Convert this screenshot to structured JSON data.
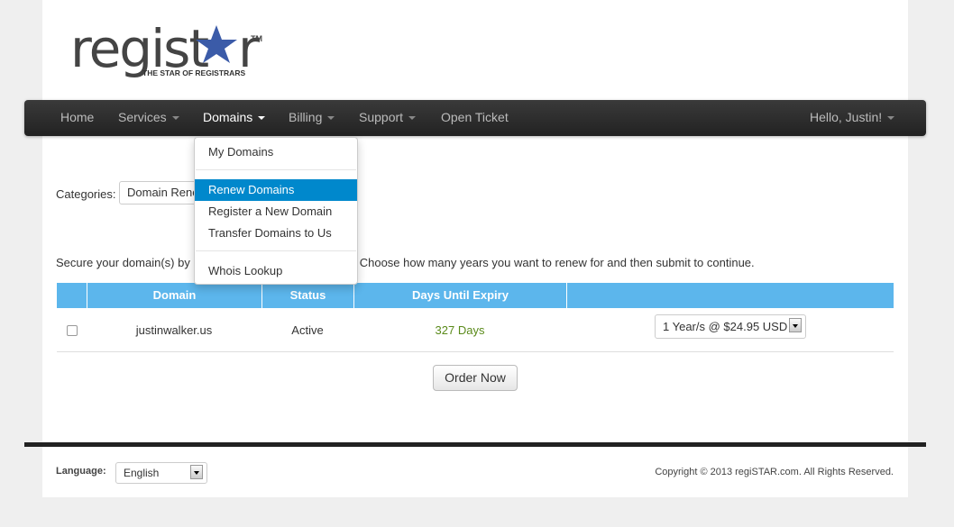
{
  "logo": {
    "word": "regist★r",
    "tagline": "THE STAR OF REGISTRARS",
    "tm": "TM",
    "star_color": "#3b5ba8"
  },
  "nav": {
    "items": [
      {
        "label": "Home"
      },
      {
        "label": "Services"
      },
      {
        "label": "Domains"
      },
      {
        "label": "Billing"
      },
      {
        "label": "Support"
      },
      {
        "label": "Open Ticket"
      }
    ],
    "user": "Hello, Justin!"
  },
  "domains_menu": {
    "items": [
      "My Domains",
      "Renew Domains",
      "Register a New Domain",
      "Transfer Domains to Us",
      "Whois Lookup"
    ],
    "active": "Renew Domains"
  },
  "categories": {
    "label": "Categories:",
    "value": "Domain Renewals"
  },
  "intro": "Secure your domain(s) by adding them to your cart below. Choose how many years you want to renew for and then submit to continue.",
  "table": {
    "headers": [
      "",
      "Domain",
      "Status",
      "Days Until Expiry",
      ""
    ],
    "rows": [
      {
        "checked": false,
        "domain": "justinwalker.us",
        "status": "Active",
        "days": "327 Days",
        "term": "1 Year/s @ $24.95 USD"
      }
    ]
  },
  "order_button": "Order Now",
  "footer": {
    "language_label": "Language:",
    "language": "English",
    "copyright": "Copyright © 2013 regiSTAR.com. All Rights Reserved."
  },
  "colors": {
    "table_header": "#5cb6ec",
    "active_menu": "#0088cc",
    "days_green": "#5a8a1a"
  }
}
